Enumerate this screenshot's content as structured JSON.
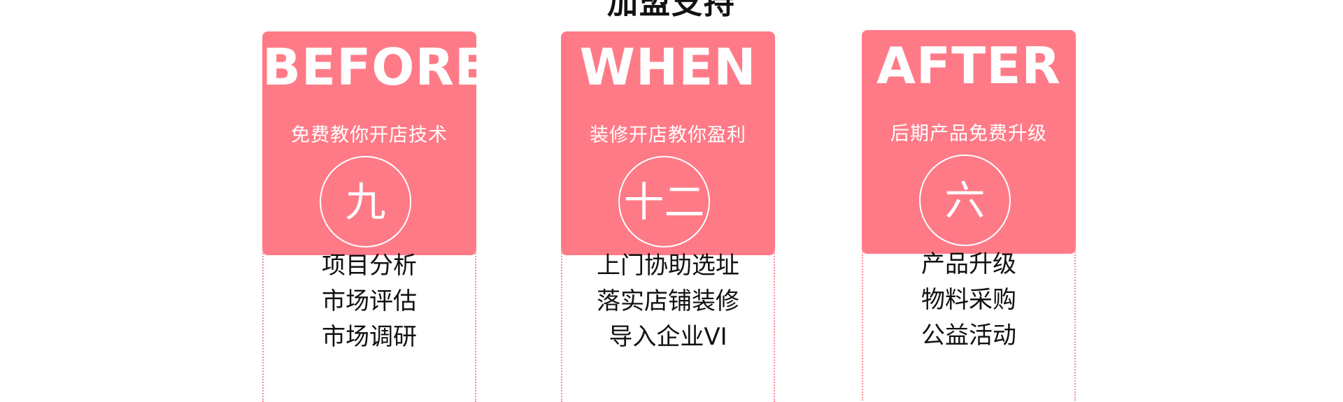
{
  "page_title": "加盟支持",
  "cards": [
    {
      "big": "BEFORE",
      "sub": "免费教你开店技术",
      "circle": "九",
      "items": [
        "项目分析",
        "市场评估",
        "市场调研"
      ]
    },
    {
      "big": "WHEN",
      "sub": "装修开店教你盈利",
      "circle": "十二",
      "items": [
        "上门协助选址",
        "落实店铺装修",
        "导入企业VI"
      ]
    },
    {
      "big": "AFTER",
      "sub": "后期产品免费升级",
      "circle": "六",
      "items": [
        "产品升级",
        "物料采购",
        "公益活动"
      ]
    }
  ],
  "colors": {
    "card_bg": "#ff7a87",
    "border": "#ff8a96",
    "text": "#111111"
  }
}
